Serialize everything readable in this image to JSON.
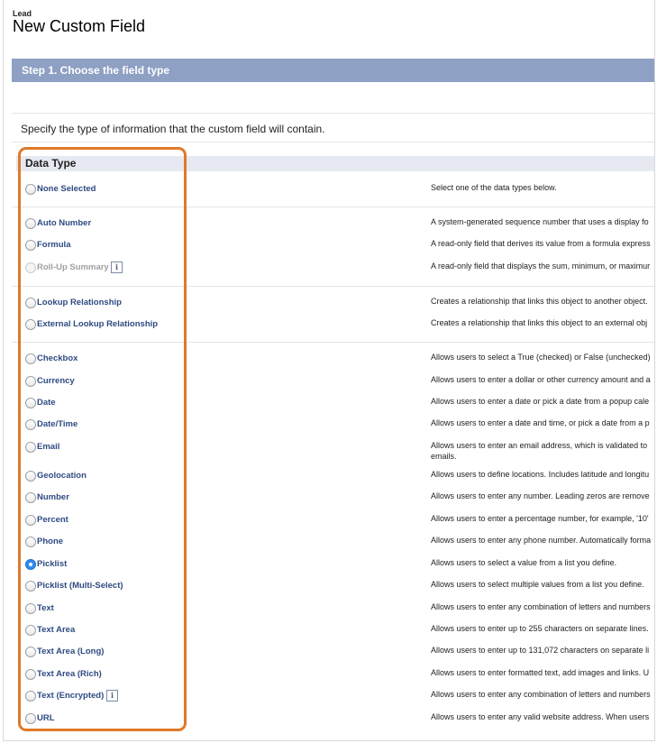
{
  "header": {
    "object_label": "Lead",
    "title": "New Custom Field"
  },
  "step": {
    "title": "Step 1. Choose the field type"
  },
  "instructions": "Specify the type of information that the custom field will contain.",
  "data_type_header": "Data Type",
  "field_types": [
    {
      "label": "None Selected",
      "description": "Select one of the data types below.",
      "selected": false,
      "disabled": false,
      "info": false
    },
    {
      "label": "Auto Number",
      "description": "A system-generated sequence number that uses a display fo",
      "selected": false,
      "disabled": false,
      "info": false
    },
    {
      "label": "Formula",
      "description": "A read-only field that derives its value from a formula express",
      "selected": false,
      "disabled": false,
      "info": false
    },
    {
      "label": "Roll-Up Summary",
      "description": "A read-only field that displays the sum, minimum, or maximur",
      "selected": false,
      "disabled": true,
      "info": true
    },
    {
      "label": "Lookup Relationship",
      "description": "Creates a relationship that links this object to another object.",
      "selected": false,
      "disabled": false,
      "info": false
    },
    {
      "label": "External Lookup Relationship",
      "description": "Creates a relationship that links this object to an external obj",
      "selected": false,
      "disabled": false,
      "info": false
    },
    {
      "label": "Checkbox",
      "description": "Allows users to select a True (checked) or False (unchecked)",
      "selected": false,
      "disabled": false,
      "info": false
    },
    {
      "label": "Currency",
      "description": "Allows users to enter a dollar or other currency amount and a",
      "selected": false,
      "disabled": false,
      "info": false
    },
    {
      "label": "Date",
      "description": "Allows users to enter a date or pick a date from a popup cale",
      "selected": false,
      "disabled": false,
      "info": false
    },
    {
      "label": "Date/Time",
      "description": "Allows users to enter a date and time, or pick a date from a p",
      "selected": false,
      "disabled": false,
      "info": false
    },
    {
      "label": "Email",
      "description": "Allows users to enter an email address, which is validated to",
      "description_line2": "emails.",
      "selected": false,
      "disabled": false,
      "info": false
    },
    {
      "label": "Geolocation",
      "description": "Allows users to define locations. Includes latitude and longitu",
      "selected": false,
      "disabled": false,
      "info": false
    },
    {
      "label": "Number",
      "description": "Allows users to enter any number. Leading zeros are remove",
      "selected": false,
      "disabled": false,
      "info": false
    },
    {
      "label": "Percent",
      "description": "Allows users to enter a percentage number, for example, '10'",
      "selected": false,
      "disabled": false,
      "info": false
    },
    {
      "label": "Phone",
      "description": "Allows users to enter any phone number. Automatically forma",
      "selected": false,
      "disabled": false,
      "info": false
    },
    {
      "label": "Picklist",
      "description": "Allows users to select a value from a list you define.",
      "selected": true,
      "disabled": false,
      "info": false
    },
    {
      "label": "Picklist (Multi-Select)",
      "description": "Allows users to select multiple values from a list you define.",
      "selected": false,
      "disabled": false,
      "info": false
    },
    {
      "label": "Text",
      "description": "Allows users to enter any combination of letters and numbers",
      "selected": false,
      "disabled": false,
      "info": false
    },
    {
      "label": "Text Area",
      "description": "Allows users to enter up to 255 characters on separate lines.",
      "selected": false,
      "disabled": false,
      "info": false
    },
    {
      "label": "Text Area (Long)",
      "description": "Allows users to enter up to 131,072 characters on separate li",
      "selected": false,
      "disabled": false,
      "info": false
    },
    {
      "label": "Text Area (Rich)",
      "description": "Allows users to enter formatted text, add images and links. U",
      "selected": false,
      "disabled": false,
      "info": false
    },
    {
      "label": "Text (Encrypted)",
      "description": "Allows users to enter any combination of letters and numbers",
      "selected": false,
      "disabled": false,
      "info": true
    },
    {
      "label": "URL",
      "description": "Allows users to enter any valid website address. When users",
      "selected": false,
      "disabled": false,
      "info": false
    }
  ],
  "info_glyph": "i",
  "colors": {
    "step_header": "#8ea0c3",
    "label_link": "#2e4a82",
    "highlight_border": "#e07928",
    "selected_radio": "#2f8cf0"
  }
}
